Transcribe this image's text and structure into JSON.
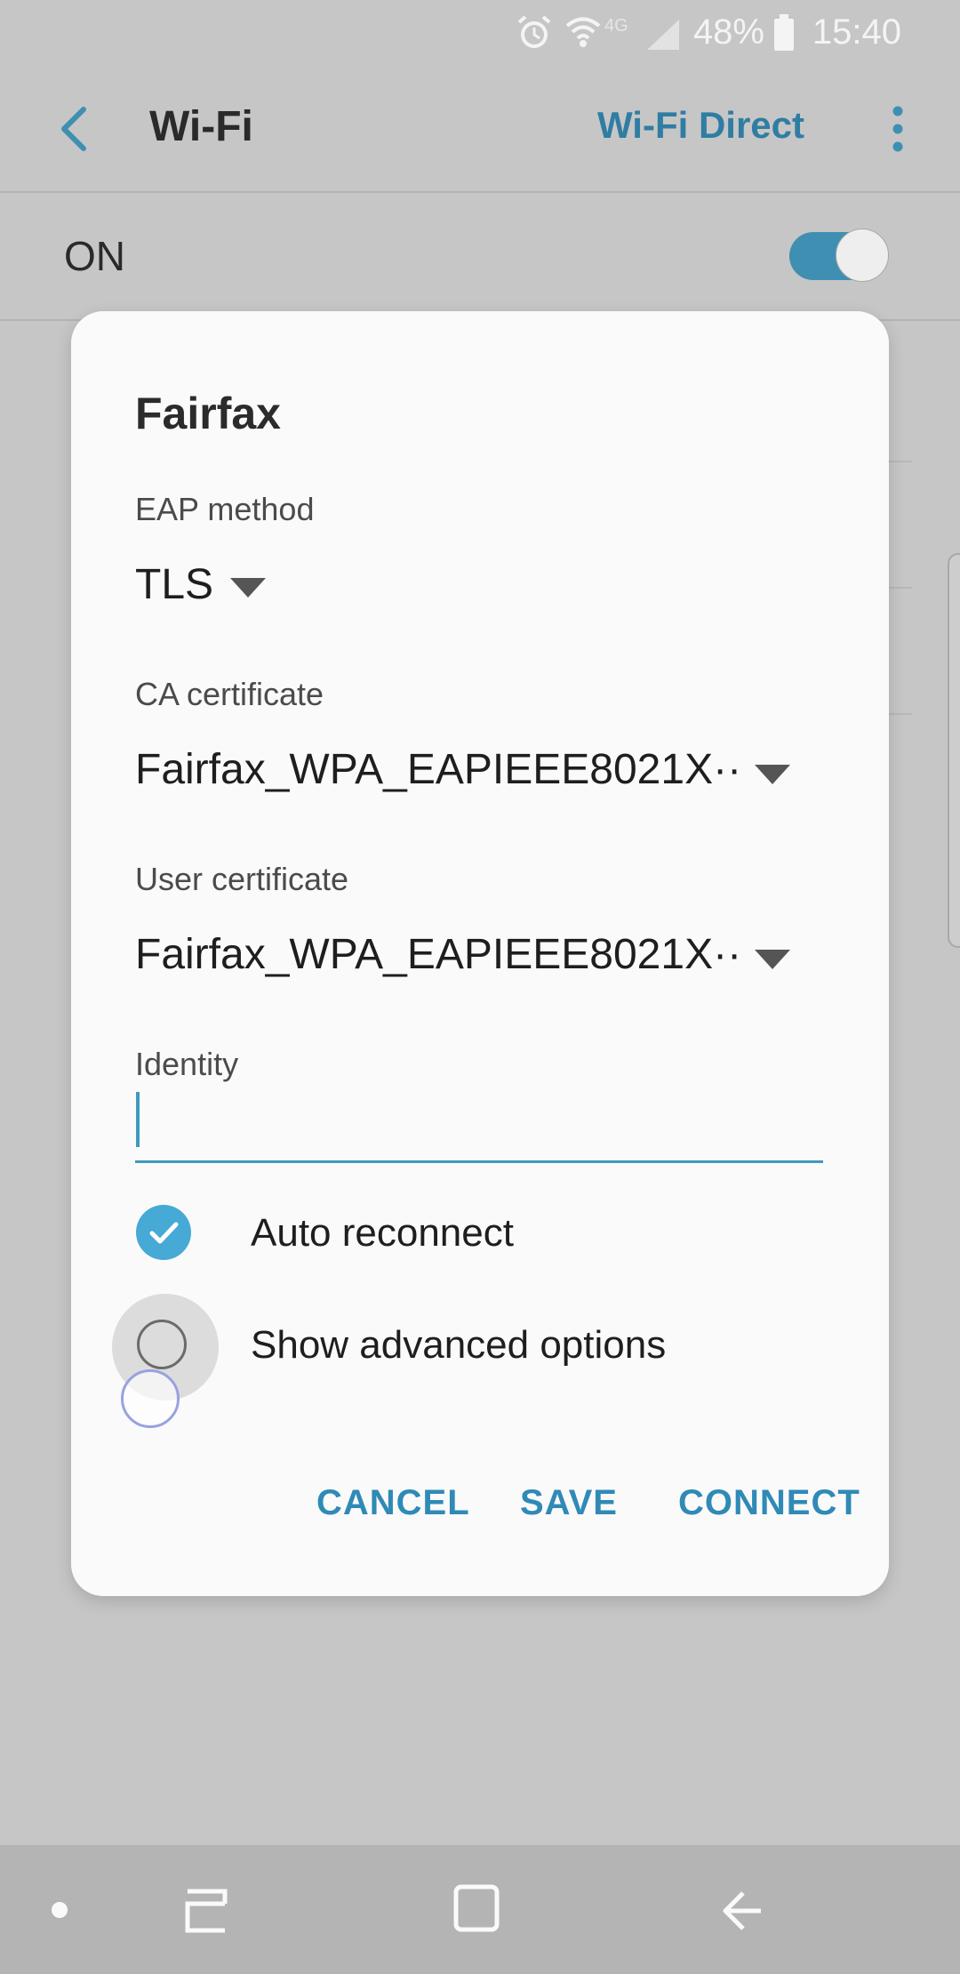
{
  "status_bar": {
    "network": "4G",
    "battery": "48%",
    "time": "15:40"
  },
  "app_bar": {
    "title": "Wi-Fi",
    "wifi_direct_label": "Wi-Fi Direct"
  },
  "wifi_toggle": {
    "label": "ON",
    "enabled": true
  },
  "dialog": {
    "title": "Fairfax",
    "eap_method": {
      "label": "EAP method",
      "value": "TLS"
    },
    "ca_certificate": {
      "label": "CA certificate",
      "value": "Fairfax_WPA_EAPIEEE8021X··"
    },
    "user_certificate": {
      "label": "User certificate",
      "value": "Fairfax_WPA_EAPIEEE8021X··"
    },
    "identity": {
      "label": "Identity",
      "value": ""
    },
    "auto_reconnect": {
      "label": "Auto reconnect",
      "checked": true
    },
    "show_advanced": {
      "label": "Show advanced options",
      "checked": false
    },
    "buttons": {
      "cancel": "CANCEL",
      "save": "SAVE",
      "connect": "CONNECT"
    }
  },
  "colors": {
    "accent": "#2f8ab6",
    "toggle_track": "#3f8fb2",
    "checkbox": "#46a9d6",
    "dim_background": "#c6c6c6",
    "dialog_background": "#fafafa"
  }
}
